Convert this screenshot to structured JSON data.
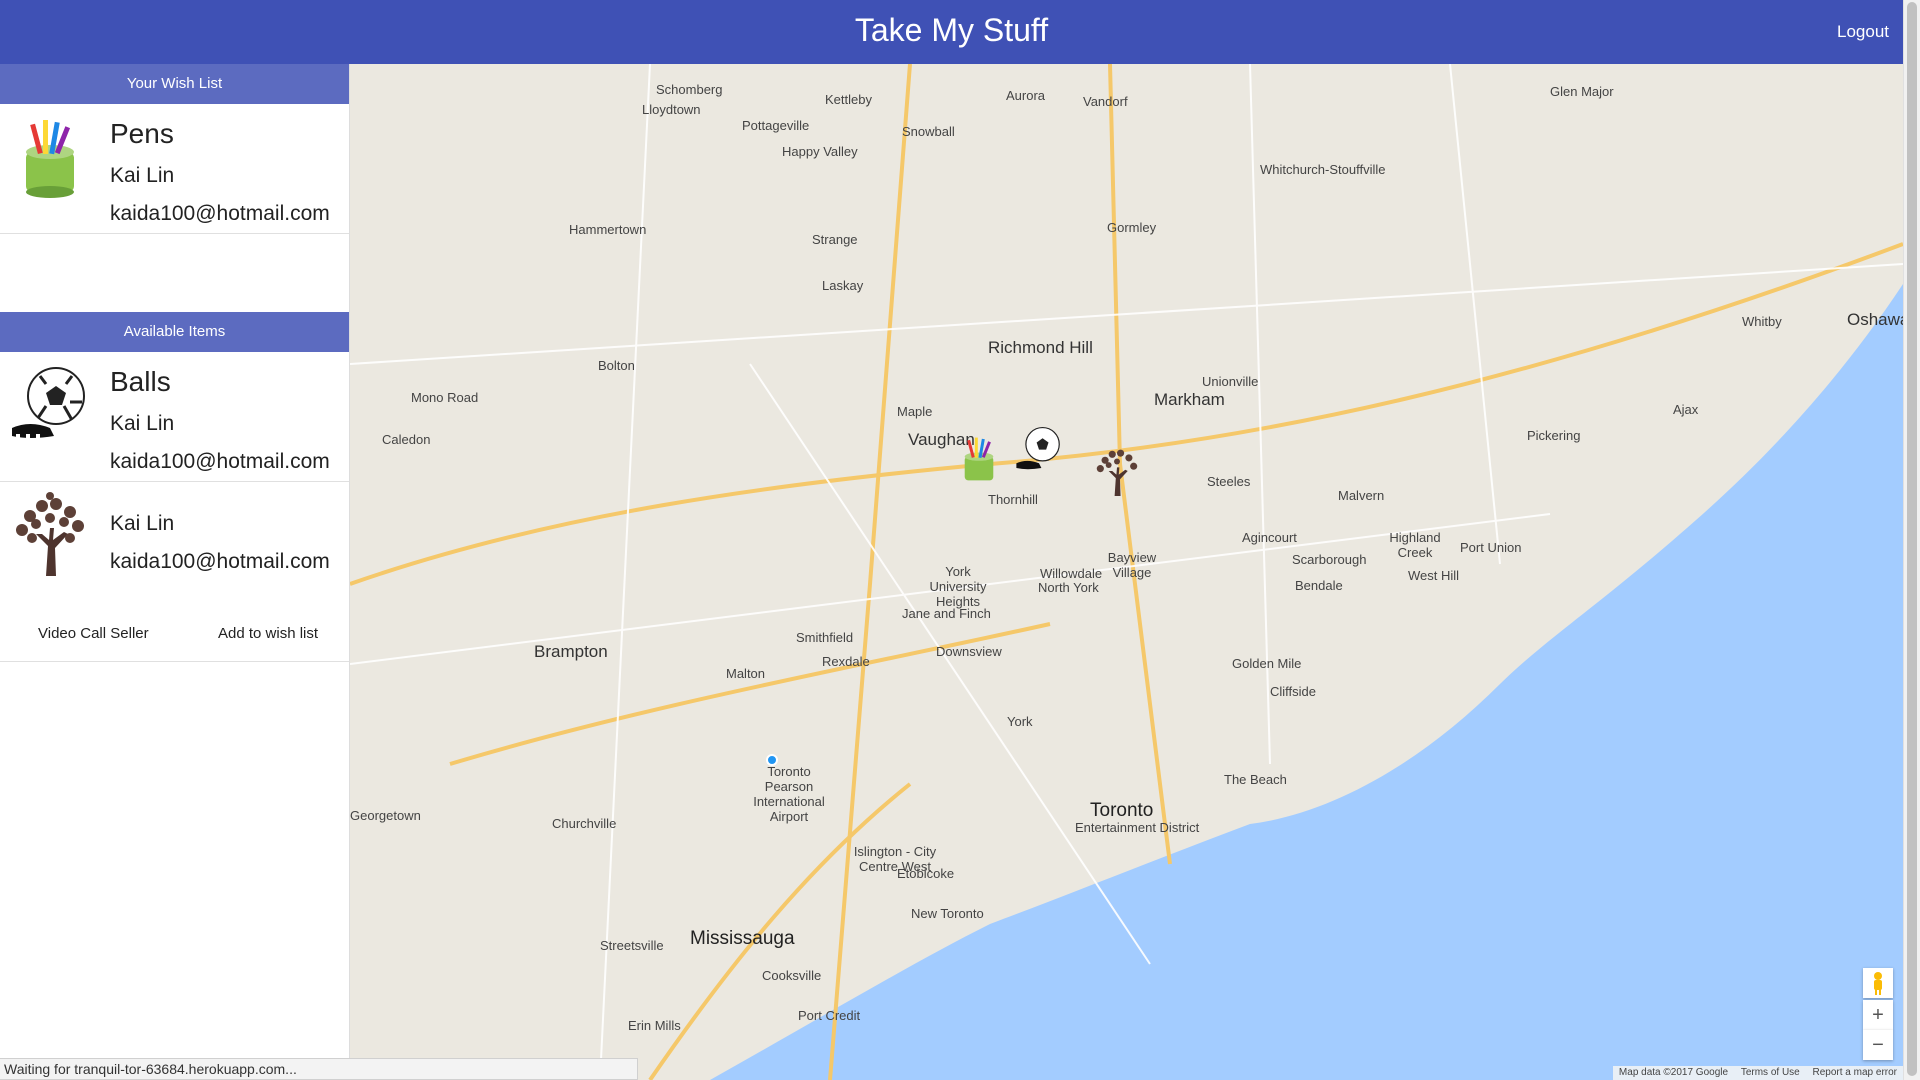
{
  "app": {
    "title": "Take My Stuff",
    "logout": "Logout"
  },
  "wishlist": {
    "header": "Your Wish List",
    "items": [
      {
        "name": "Pens",
        "owner": "Kai Lin",
        "email": "kaida100@hotmail.com",
        "icon": "pencil-cup-icon"
      }
    ]
  },
  "available": {
    "header": "Available Items",
    "items": [
      {
        "name": "Balls",
        "owner": "Kai Lin",
        "email": "kaida100@hotmail.com",
        "icon": "soccer-ball-icon"
      },
      {
        "name": "",
        "owner": "Kai Lin",
        "email": "kaida100@hotmail.com",
        "icon": "tree-icon"
      }
    ],
    "actions": {
      "video_call": "Video Call Seller",
      "add_wish": "Add to wish list"
    }
  },
  "map": {
    "labels": [
      "Schomberg",
      "Lloydtown",
      "Pottageville",
      "Kettleby",
      "Aurora",
      "Vandorf",
      "Glen Major",
      "Happy Valley",
      "Snowball",
      "Whitchurch-Stouffville",
      "Hammertown",
      "Strange",
      "Gormley",
      "Laskay",
      "Richmond Hill",
      "Markham",
      "Whitby",
      "Oshawa",
      "Ajax",
      "Pickering",
      "Vaughan",
      "Bolton",
      "Mono Road",
      "Caledon",
      "Brampton",
      "North York",
      "Scarborough",
      "Toronto",
      "Toronto Pearson International Airport",
      "Mississauga",
      "Etobicoke",
      "Maple",
      "Thornhill",
      "Malvern",
      "Agincourt",
      "Bayview Village",
      "Willowdale",
      "York University Heights",
      "Jane and Finch",
      "Downsview",
      "York",
      "Golden Mile",
      "Cliffside",
      "Malton",
      "Smithfield",
      "Rexdale",
      "Islington - City Centre West",
      "New Toronto",
      "Port Credit",
      "Erin Mills",
      "Streetsville",
      "Cooksville",
      "Churchville",
      "Georgetown",
      "Unionville",
      "Steeles",
      "Highland Creek",
      "Port Union",
      "West Hill",
      "Bendale",
      "The Beach",
      "Entertainment District"
    ],
    "markers": [
      "pencil-cup-marker",
      "soccer-ball-marker",
      "tree-marker"
    ],
    "controls": {
      "zoom_in": "+",
      "zoom_out": "−"
    },
    "attribution": {
      "data": "Map data ©2017 Google",
      "terms": "Terms of Use",
      "report": "Report a map error"
    }
  },
  "status": "Waiting for tranquil-tor-63684.herokuapp.com..."
}
